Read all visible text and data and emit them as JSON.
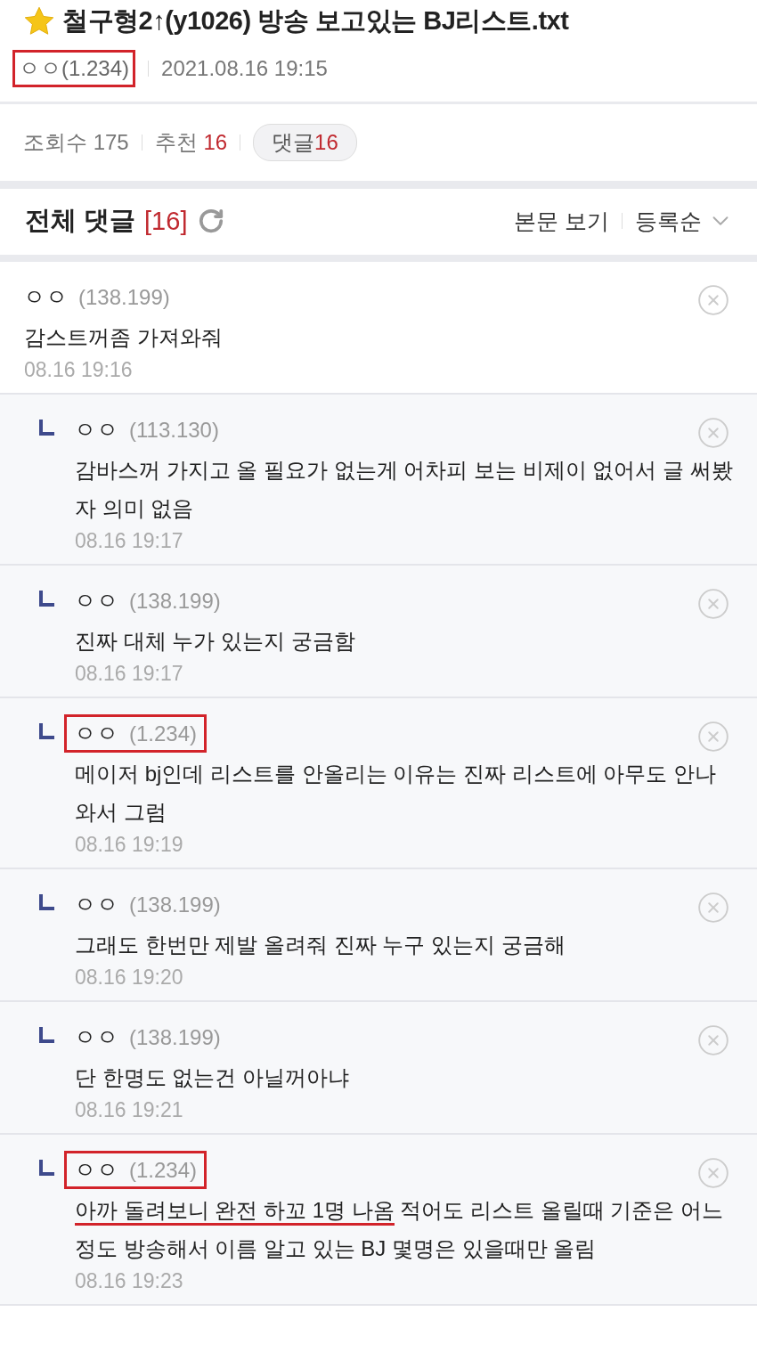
{
  "post": {
    "title": "철구형2↑(y1026) 방송 보고있는 BJ리스트.txt",
    "author": "ㅇㅇ(1.234)",
    "author_highlighted": true,
    "date": "2021.08.16 19:15"
  },
  "stats": {
    "views_label": "조회수",
    "views": "175",
    "likes_label": "추천",
    "likes": "16",
    "comments_label": "댓글",
    "comments": "16"
  },
  "comments_header": {
    "title": "전체 댓글",
    "count": "[16]",
    "view_body": "본문 보기",
    "sort": "등록순"
  },
  "comments": [
    {
      "kind": "comment",
      "nick": "ㅇㅇ",
      "ip": "(138.199)",
      "highlighted": false,
      "text": "감스트꺼좀 가져와줘",
      "date": "08.16 19:16"
    },
    {
      "kind": "reply",
      "nick": "ㅇㅇ",
      "ip": "(113.130)",
      "highlighted": false,
      "text": "감바스꺼 가지고 올 필요가 없는게 어차피 보는 비제이 없어서 글 써봤자 의미 없음",
      "date": "08.16 19:17"
    },
    {
      "kind": "reply",
      "nick": "ㅇㅇ",
      "ip": "(138.199)",
      "highlighted": false,
      "text": "진짜 대체 누가 있는지 궁금함",
      "date": "08.16 19:17"
    },
    {
      "kind": "reply",
      "nick": "ㅇㅇ",
      "ip": "(1.234)",
      "highlighted": true,
      "text": "메이저 bj인데 리스트를 안올리는 이유는 진짜 리스트에 아무도 안나와서 그럼",
      "date": "08.16 19:19"
    },
    {
      "kind": "reply",
      "nick": "ㅇㅇ",
      "ip": "(138.199)",
      "highlighted": false,
      "text": "그래도 한번만 제발 올려줘 진짜 누구 있는지 궁금해",
      "date": "08.16 19:20"
    },
    {
      "kind": "reply",
      "nick": "ㅇㅇ",
      "ip": "(138.199)",
      "highlighted": false,
      "text": "단 한명도 없는건 아닐꺼아냐",
      "date": "08.16 19:21"
    },
    {
      "kind": "reply",
      "nick": "ㅇㅇ",
      "ip": "(1.234)",
      "highlighted": true,
      "underlined_text": "아까 돌려보니 완전 하꼬 1명 나옴",
      "text": " 적어도 리스트 올릴때 기준은 어느정도 방송해서 이름 알고 있는 BJ 몇명은 있을때만 올림",
      "date": "08.16 19:23"
    }
  ]
}
